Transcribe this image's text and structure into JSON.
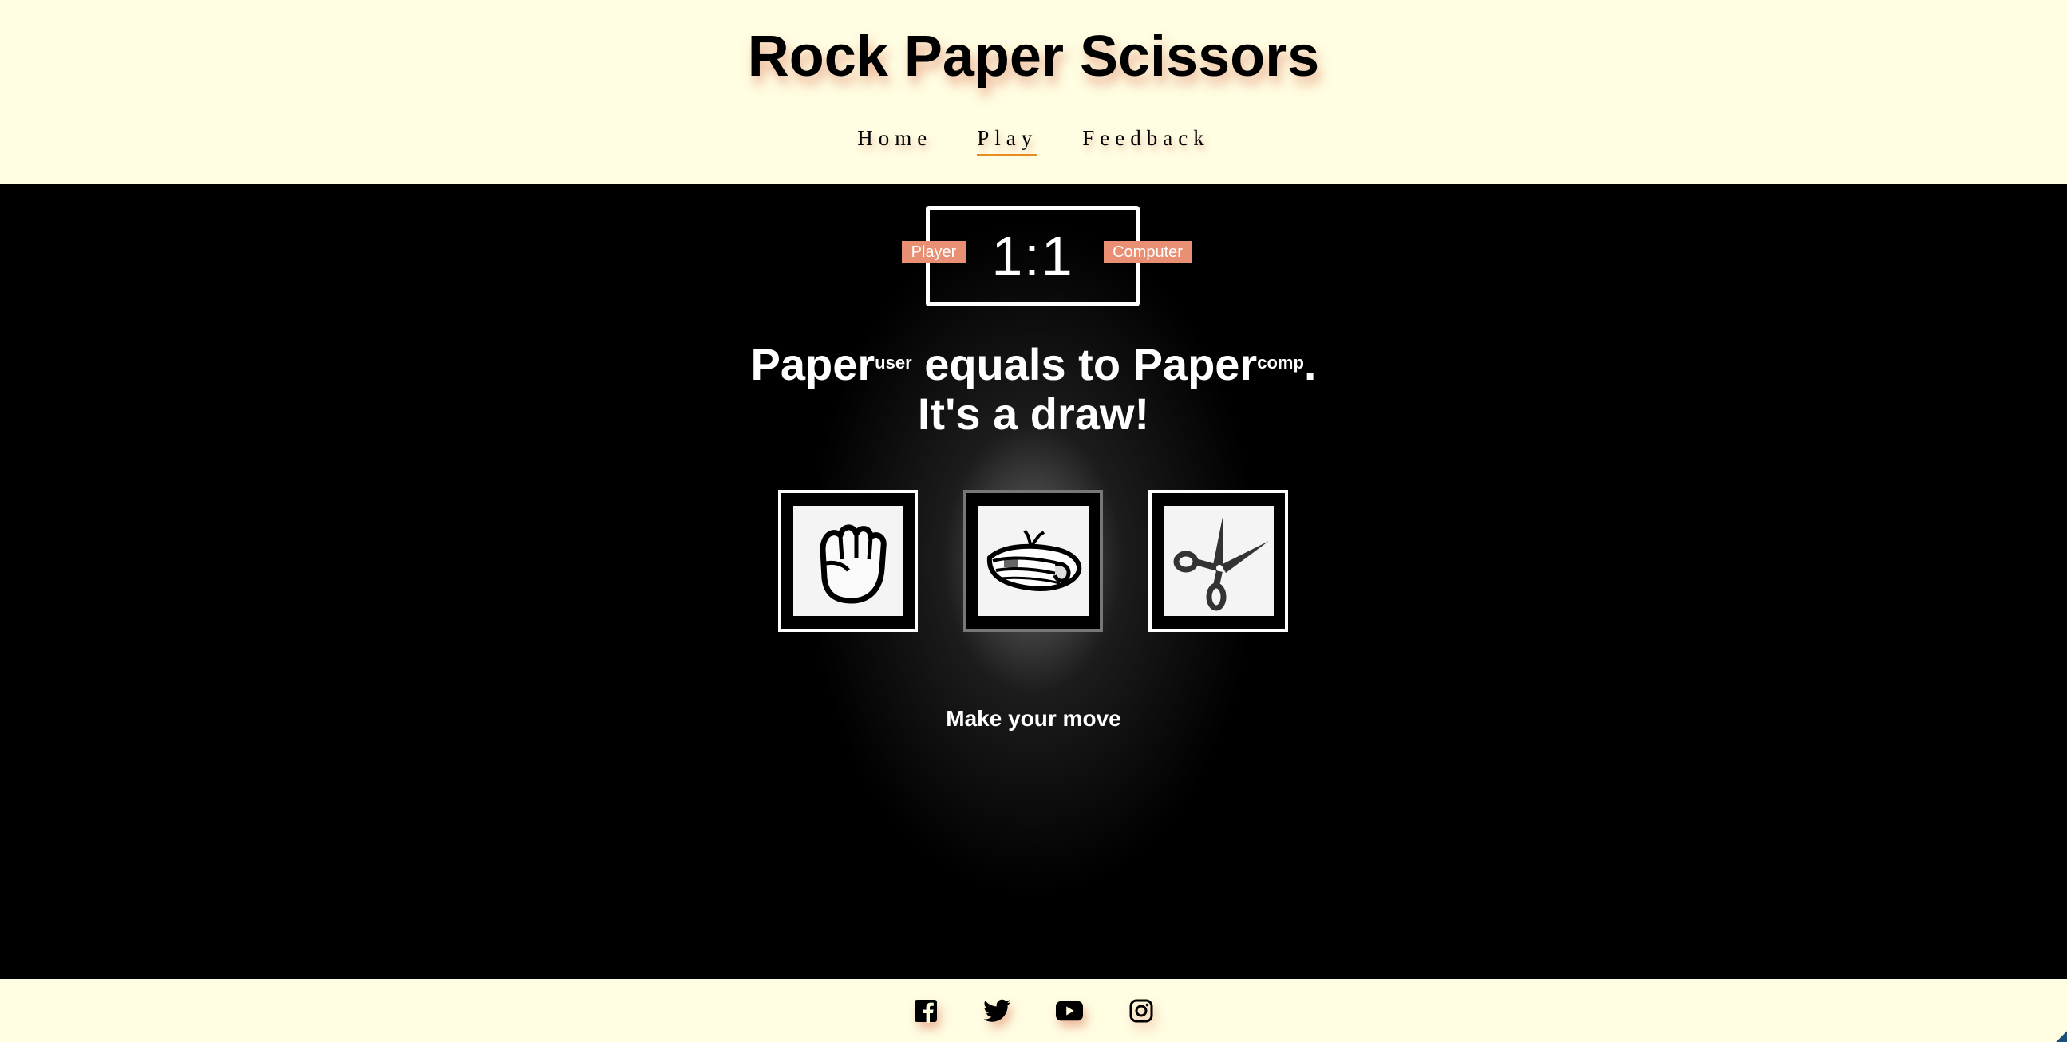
{
  "header": {
    "title": "Rock Paper Scissors",
    "nav": [
      {
        "label": "Home",
        "active": false
      },
      {
        "label": "Play",
        "active": true
      },
      {
        "label": "Feedback",
        "active": false
      }
    ]
  },
  "game": {
    "player_label": "Player",
    "computer_label": "Computer",
    "score": "1:1",
    "result": {
      "user_choice": "Paper",
      "user_tag": "user",
      "verb": " equals to ",
      "comp_choice": "Paper",
      "comp_tag": "comp",
      "end": ".",
      "outcome": "It's a draw!"
    },
    "choices": [
      {
        "name": "rock",
        "icon": "fist-icon",
        "selected": false
      },
      {
        "name": "paper",
        "icon": "newspaper-icon",
        "selected": true
      },
      {
        "name": "scissors",
        "icon": "scissors-icon",
        "selected": false
      }
    ],
    "prompt": "Make your move"
  },
  "footer": {
    "social": [
      "facebook-icon",
      "twitter-icon",
      "youtube-icon",
      "instagram-icon"
    ]
  },
  "colors": {
    "background": "#fffde2",
    "game_background": "#000000",
    "badge": "#e98f73",
    "nav_underline": "#e78c1f"
  }
}
